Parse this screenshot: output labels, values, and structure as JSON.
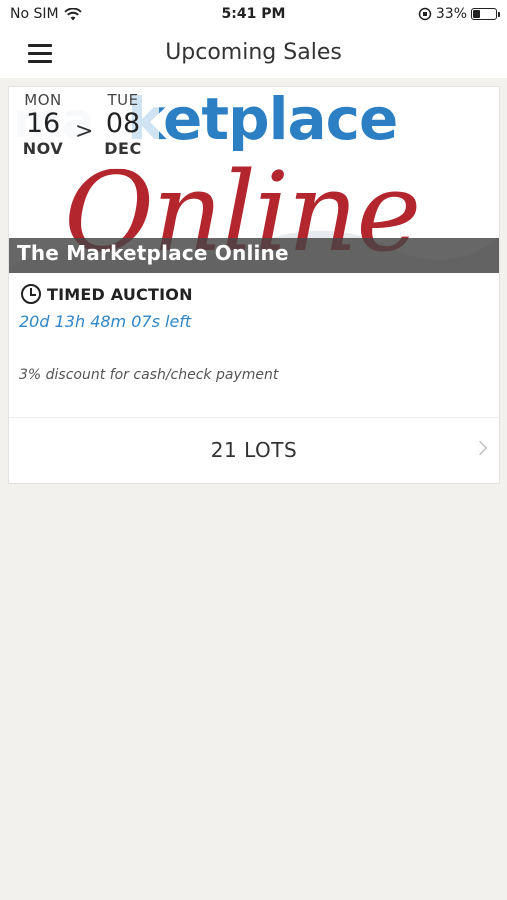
{
  "status_bar": {
    "carrier": "No SIM",
    "time": "5:41 PM",
    "battery_percent": "33%",
    "battery_level": 0.33
  },
  "nav": {
    "title": "Upcoming Sales",
    "menu_icon": "hamburger-menu-icon"
  },
  "sale": {
    "banner_text": {
      "watermark": "ma",
      "word": "ketplace",
      "script": "Online"
    },
    "start": {
      "dow": "MON",
      "day": "16",
      "month": "NOV"
    },
    "separator": ">",
    "end": {
      "dow": "TUE",
      "day": "08",
      "month": "DEC"
    },
    "title": "The Marketplace Online",
    "type_icon": "clock-icon",
    "type": "TIMED AUCTION",
    "time_left": "20d 13h 48m 07s left",
    "note": "3% discount for cash/check payment",
    "lots_label": "21 LOTS",
    "lots_icon": "chevron-right-icon"
  },
  "colors": {
    "accent_blue": "#2f86c8",
    "logo_red": "#b3262e",
    "background": "#f2f1ee"
  }
}
